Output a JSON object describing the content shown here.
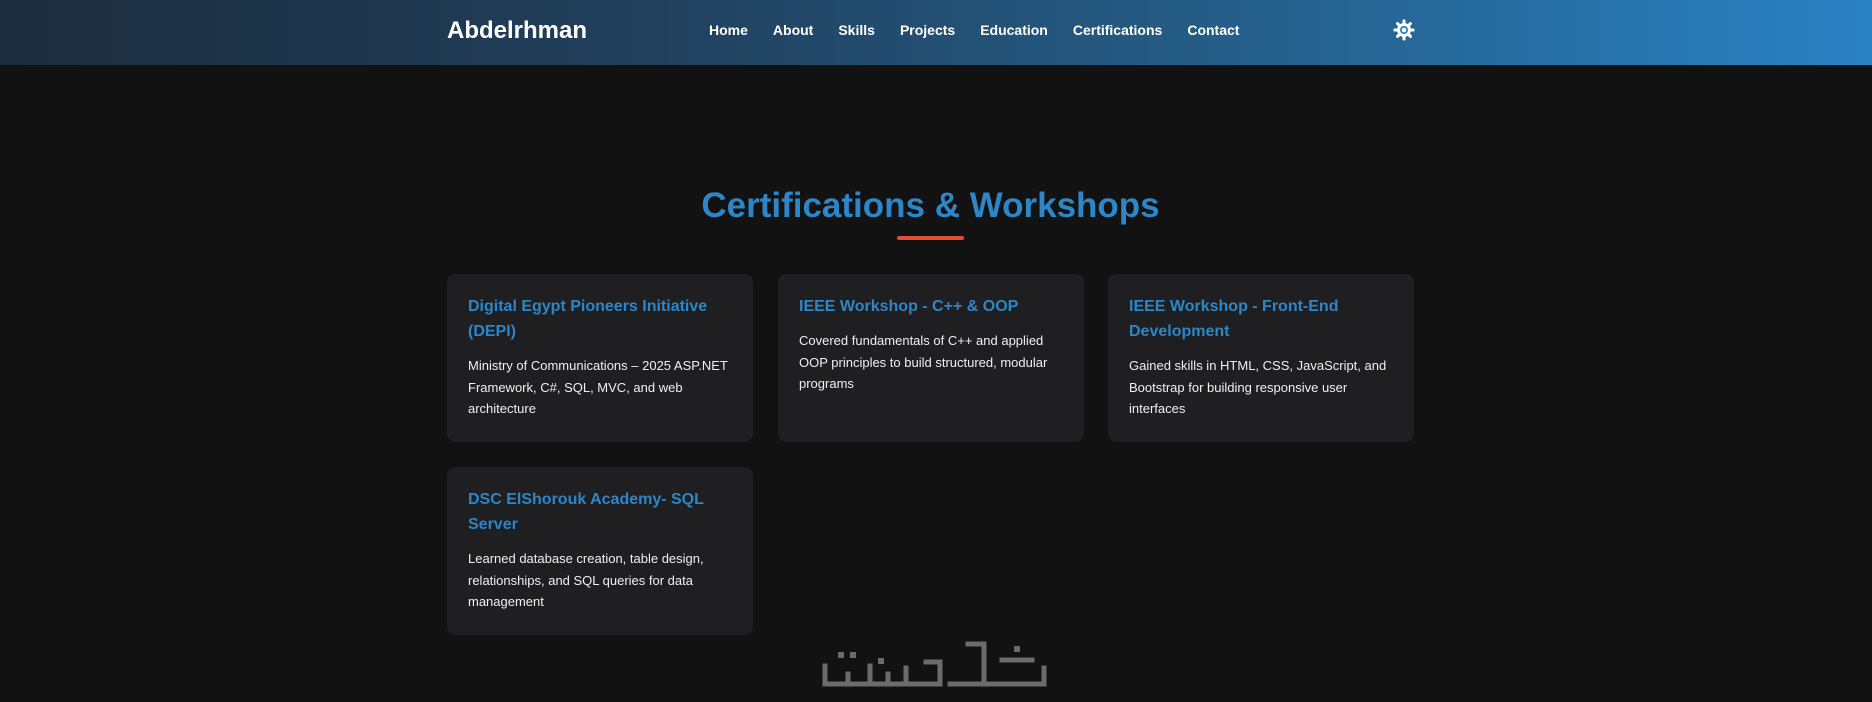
{
  "header": {
    "brand": "Abdelrhman",
    "nav": [
      "Home",
      "About",
      "Skills",
      "Projects",
      "Education",
      "Certifications",
      "Contact"
    ],
    "theme_icon": "gear-sun-icon"
  },
  "section": {
    "title": "Certifications & Workshops",
    "accent_color": "#2c86c7",
    "underline_color": "#e04e3a"
  },
  "cards": [
    {
      "title": "Digital Egypt Pioneers Initiative (DEPI)",
      "body": "Ministry of Communications – 2025 ASP.NET Framework, C#, SQL, MVC, and web architecture"
    },
    {
      "title": "IEEE Workshop - C++ & OOP",
      "body": "Covered fundamentals of C++ and applied OOP principles to build structured, modular programs"
    },
    {
      "title": "IEEE Workshop - Front-End Development",
      "body": "Gained skills in HTML, CSS, JavaScript, and Bootstrap for building responsive user interfaces"
    },
    {
      "title": "DSC ElShorouk Academy- SQL Server",
      "body": "Learned database creation, table design, relationships, and SQL queries for data management"
    }
  ],
  "colors": {
    "background": "#121212",
    "card_background": "#1f1f21",
    "header_gradient_start": "#1d2c3c",
    "header_gradient_end": "#2a82c4"
  }
}
